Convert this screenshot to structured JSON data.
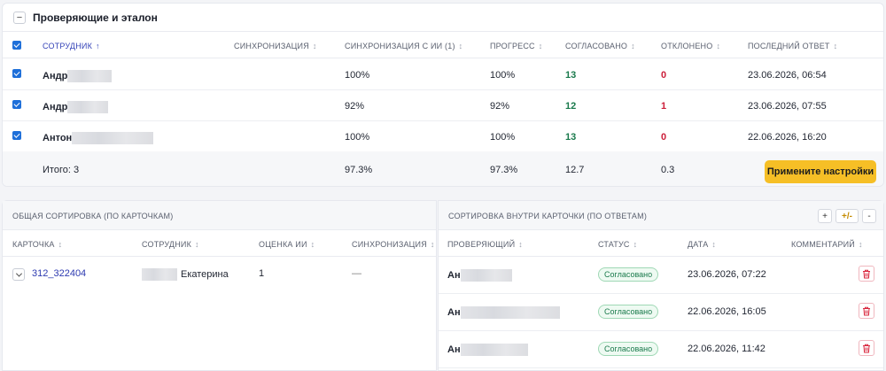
{
  "section": {
    "title": "Проверяющие и эталон",
    "collapse_symbol": "−"
  },
  "columns": {
    "employee": "СОТРУДНИК",
    "sync": "СИНХРОНИЗАЦИЯ",
    "sync_ai": "СИНХРОНИЗАЦИЯ С ИИ (1)",
    "progress": "ПРОГРЕСС",
    "agreed": "СОГЛАСОВАНО",
    "rejected": "ОТКЛОНЕНО",
    "last_answer": "ПОСЛЕДНИЙ ОТВЕТ",
    "sort_active": "↑",
    "sort_both": "↕"
  },
  "rows": [
    {
      "name": "Андр",
      "sync_ai": "100%",
      "progress": "100%",
      "agreed": "13",
      "rejected": "0",
      "last": "23.06.2026, 06:54"
    },
    {
      "name": "Андр",
      "sync_ai": "92%",
      "progress": "92%",
      "agreed": "12",
      "rejected": "1",
      "last": "23.06.2026, 07:55"
    },
    {
      "name": "Антон",
      "sync_ai": "100%",
      "progress": "100%",
      "agreed": "13",
      "rejected": "0",
      "last": "22.06.2026, 16:20"
    }
  ],
  "total": {
    "label": "Итого: 3",
    "sync_ai": "97.3%",
    "progress": "97.3%",
    "agreed": "12.7",
    "rejected": "0.3"
  },
  "apply_button": "Примените настройки",
  "left_panel": {
    "title": "ОБЩАЯ СОРТИРОВКА (ПО КАРТОЧКАМ)",
    "columns": {
      "card": "КАРТОЧКА",
      "employee": "СОТРУДНИК",
      "ai_score": "ОЦЕНКА ИИ",
      "sync": "СИНХРОНИЗАЦИЯ"
    },
    "row": {
      "card": "312_322404",
      "employee": "Екатерина",
      "ai_score": "1",
      "sync": "—"
    }
  },
  "right_panel": {
    "title": "СОРТИРОВКА ВНУТРИ КАРТОЧКИ (ПО ОТВЕТАМ)",
    "buttons": {
      "plus": "+",
      "plus_minus": "+/-",
      "minus": "-"
    },
    "columns": {
      "reviewer": "ПРОВЕРЯЮЩИЙ",
      "status": "СТАТУС",
      "date": "ДАТА",
      "comment": "КОММЕНТАРИЙ"
    },
    "rows": [
      {
        "reviewer": "Ан",
        "status": "Согласовано",
        "date": "23.06.2026, 07:22"
      },
      {
        "reviewer": "Ан",
        "status": "Согласовано",
        "date": "22.06.2026, 16:05"
      },
      {
        "reviewer": "Ан",
        "status": "Согласовано",
        "date": "22.06.2026, 11:42"
      }
    ]
  },
  "colors": {
    "primary": "#1e6fd9",
    "accent_yellow": "#f6bf26",
    "agreed_green": "#1a7a4c",
    "rejected_red": "#cc1f3a",
    "link": "#2d3ab0"
  }
}
